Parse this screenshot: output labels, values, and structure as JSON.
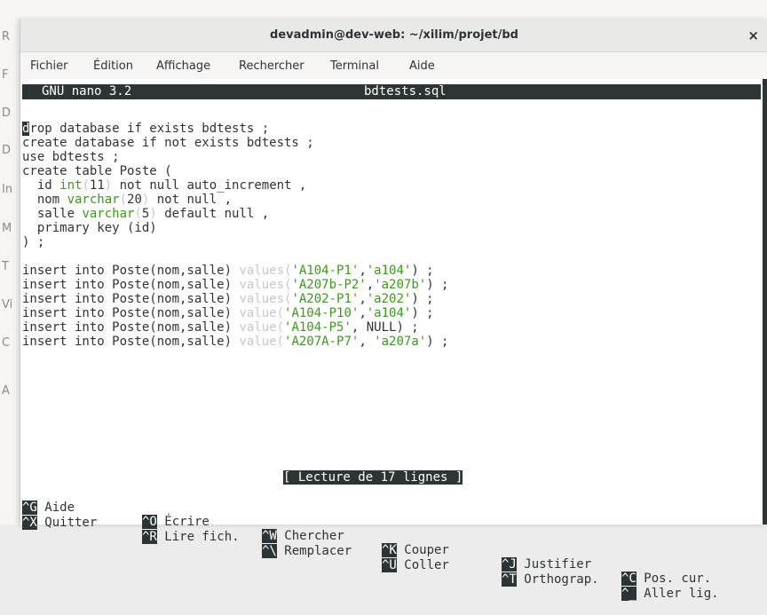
{
  "background_app": {
    "labels": [
      "R",
      "F",
      "D",
      "D",
      "In",
      "M",
      "T",
      "Vi",
      "C",
      "A"
    ]
  },
  "window": {
    "title": "devadmin@dev-web: ~/xilim/projet/bd",
    "close_glyph": "×"
  },
  "menu": [
    "Fichier",
    "Édition",
    "Affichage",
    "Rechercher",
    "Terminal",
    "Aide"
  ],
  "nano": {
    "version": "GNU nano 3.2",
    "filename": "bdtests.sql",
    "status": "[ Lecture de 17 lignes ]"
  },
  "code": {
    "l1_cursor": "d",
    "l1_rest": "rop database if exists bdtests ;",
    "l2": "create database if not exists bdtests ;",
    "l3": "use bdtests ;",
    "l4": "create table Poste (",
    "l5_a": "  id ",
    "l5_kw": "int",
    "l5_p1": "(",
    "l5_n": "11",
    "l5_p2": ")",
    "l5_b": " not null auto_increment ,",
    "l6_a": "  nom ",
    "l6_kw": "varchar",
    "l6_p1": "(",
    "l6_n": "20",
    "l6_p2": ")",
    "l6_b": " not null ,",
    "l7_a": "  salle ",
    "l7_kw": "varchar",
    "l7_p1": "(",
    "l7_n": "5",
    "l7_p2": ")",
    "l7_b": " default null ,",
    "l8": "  primary key (id)",
    "l9": ") ;",
    "inserts": [
      {
        "pre": "insert into Poste(nom,salle) ",
        "fn": "values(",
        "s1": "'A104-P1'",
        "mid": ",",
        "s2": "'a104'",
        "post": ") ;"
      },
      {
        "pre": "insert into Poste(nom,salle) ",
        "fn": "values(",
        "s1": "'A207b-P2'",
        "mid": ",",
        "s2": "'a207b'",
        "post": ") ;"
      },
      {
        "pre": "insert into Poste(nom,salle) ",
        "fn": "values(",
        "s1": "'A202-P1'",
        "mid": ",",
        "s2": "'a202'",
        "post": ") ;"
      },
      {
        "pre": "insert into Poste(nom,salle) ",
        "fn": "value(",
        "s1": "'A104-P10'",
        "mid": ",",
        "s2": "'a104'",
        "post": ") ;"
      },
      {
        "pre": "insert into Poste(nom,salle) ",
        "fn": "value(",
        "s1": "'A104-P5'",
        "mid": ", NULL",
        "s2": "",
        "post": ") ;"
      },
      {
        "pre": "insert into Poste(nom,salle) ",
        "fn": "value(",
        "s1": "'A207A-P7'",
        "mid": ", ",
        "s2": "'a207a'",
        "post": ") ;"
      }
    ]
  },
  "shortcuts": {
    "row1": [
      {
        "key": "^G",
        "label": " Aide"
      },
      {
        "key": "^O",
        "label": " Écrire"
      },
      {
        "key": "^W",
        "label": " Chercher"
      },
      {
        "key": "^K",
        "label": " Couper"
      },
      {
        "key": "^J",
        "label": " Justifier"
      },
      {
        "key": "^C",
        "label": " Pos. cur."
      }
    ],
    "row2": [
      {
        "key": "^X",
        "label": " Quitter"
      },
      {
        "key": "^R",
        "label": " Lire fich."
      },
      {
        "key": "^\\",
        "label": " Remplacer"
      },
      {
        "key": "^U",
        "label": " Coller"
      },
      {
        "key": "^T",
        "label": " Orthograp."
      },
      {
        "key": "^_",
        "label": " Aller lig."
      }
    ]
  },
  "colors": {
    "keyword": "#3a9a1a",
    "dim": "#c8c8c8",
    "inverse_bg": "#2e3436"
  }
}
